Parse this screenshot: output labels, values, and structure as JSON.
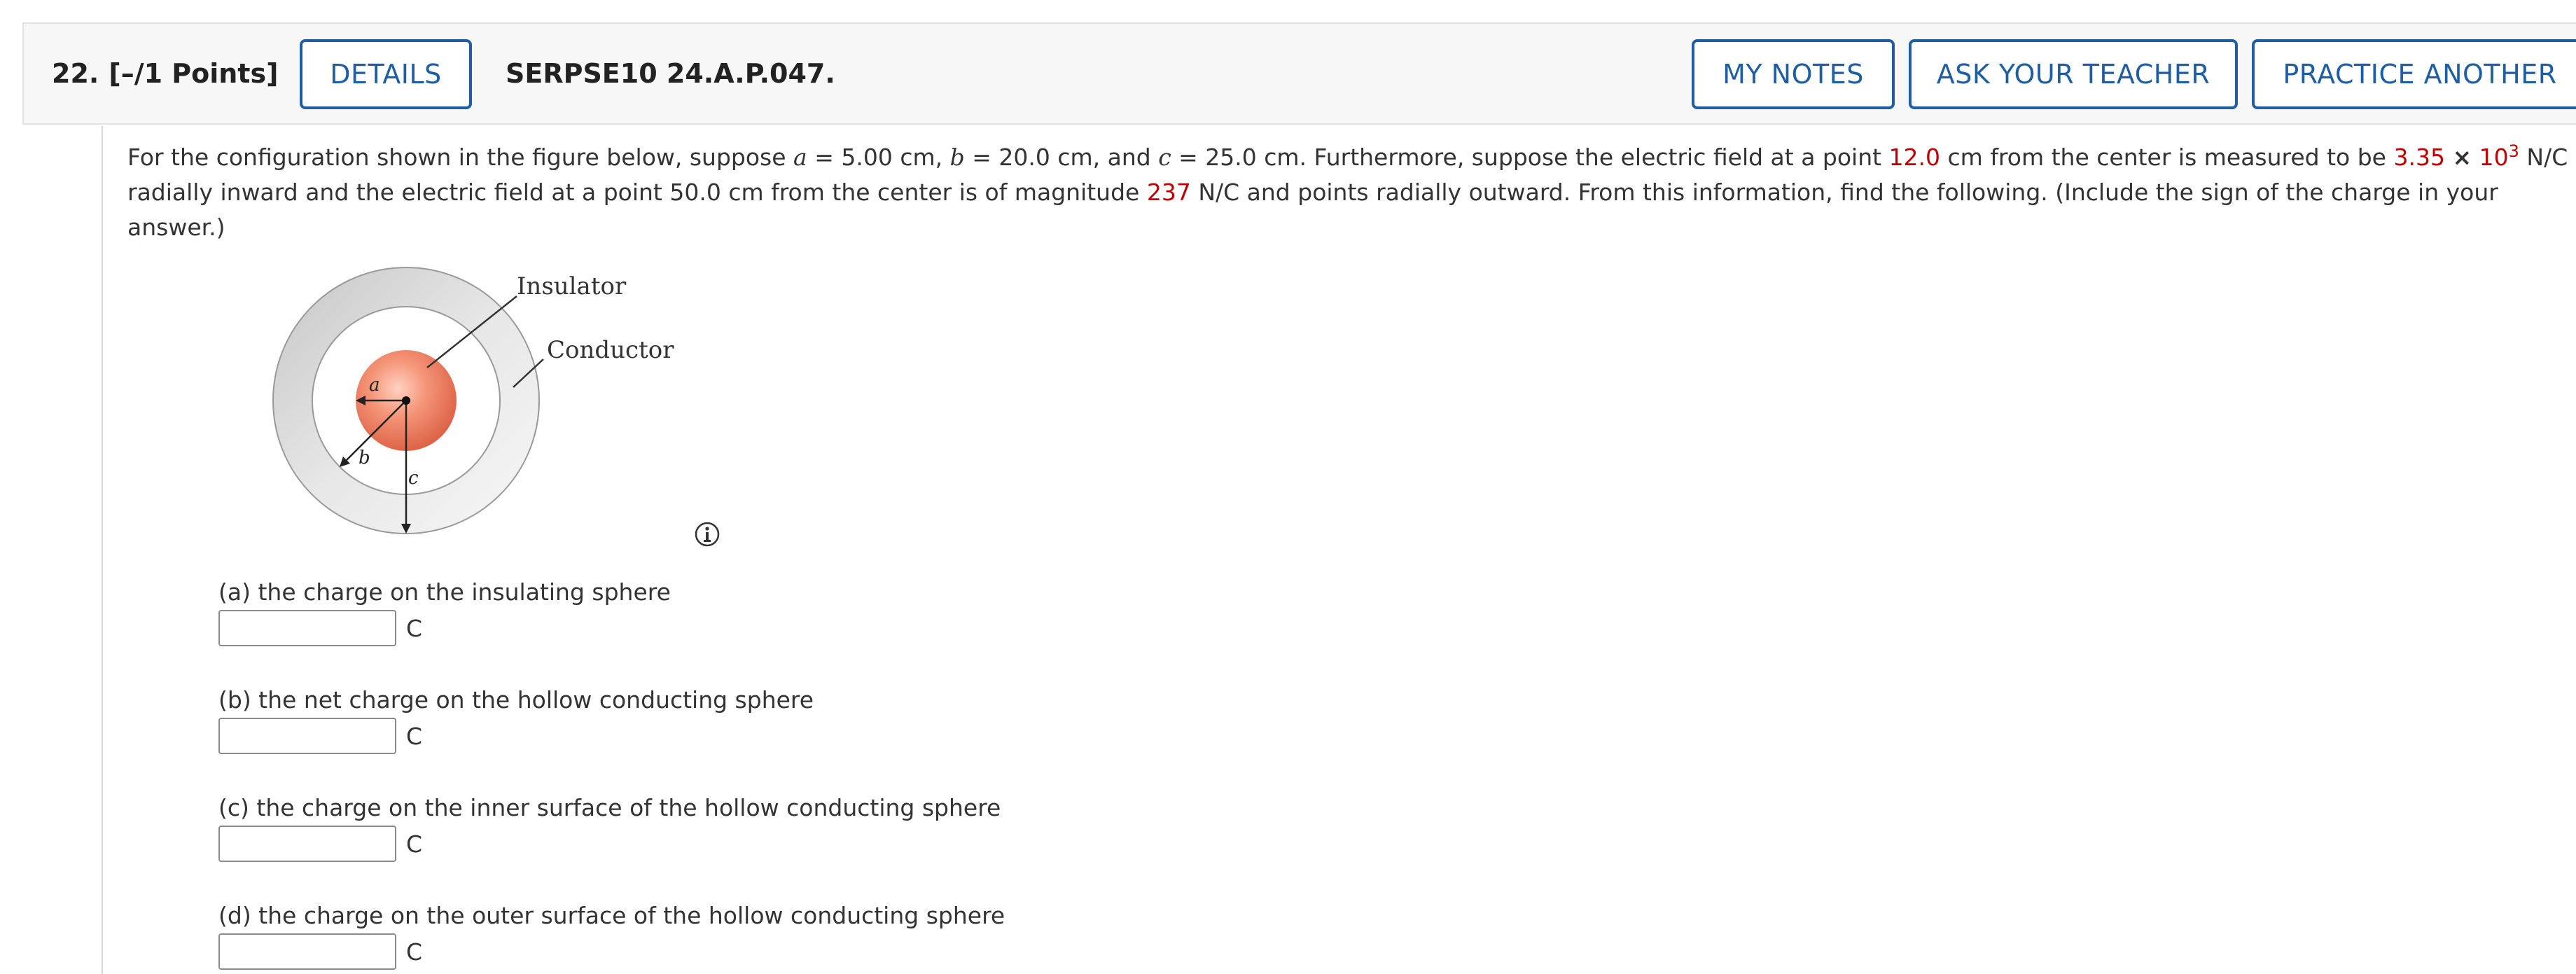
{
  "header": {
    "question_number": "22.",
    "points": "[–/1 Points]",
    "details_label": "DETAILS",
    "question_id": "SERPSE10 24.A.P.047.",
    "my_notes_label": "MY NOTES",
    "ask_teacher_label": "ASK YOUR TEACHER",
    "practice_label": "PRACTICE ANOTHER"
  },
  "problem": {
    "l1_a": "For the configuration shown in the figure below, suppose ",
    "var_a": "a",
    "l1_b": " = 5.00 cm, ",
    "var_b": "b",
    "l1_c": " = 20.0 cm, and ",
    "var_c": "c",
    "l1_d": " = 25.0 cm. Furthermore, suppose the electric field at a point ",
    "r1": "12.0",
    "l1_e": " cm from the center is measured to be ",
    "field_mantissa": "3.35",
    "times": "×",
    "field_base": "10",
    "field_exp": "3",
    "l1_f": " N/C",
    "l2_a": "radially inward and the electric field at a point 50.0 cm from the center is of magnitude ",
    "field2": "237",
    "l2_b": " N/C and points radially outward. From this information, find the following. (Include the sign of the charge in your",
    "l3": "answer.)"
  },
  "figure": {
    "insulator_label": "Insulator",
    "conductor_label": "Conductor",
    "a_label": "a",
    "b_label": "b",
    "c_label": "c"
  },
  "parts": [
    {
      "label": "(a) the charge on the insulating sphere",
      "value": "",
      "unit": "C"
    },
    {
      "label": "(b) the net charge on the hollow conducting sphere",
      "value": "",
      "unit": "C"
    },
    {
      "label": "(c) the charge on the inner surface of the hollow conducting sphere",
      "value": "",
      "unit": "C"
    },
    {
      "label": "(d) the charge on the outer surface of the hollow conducting sphere",
      "value": "",
      "unit": "C"
    }
  ],
  "colors": {
    "accent": "#1d5ea5",
    "highlight_red": "#c00000",
    "header_bg": "#f7f7f7"
  },
  "icons": [
    "info-icon"
  ]
}
